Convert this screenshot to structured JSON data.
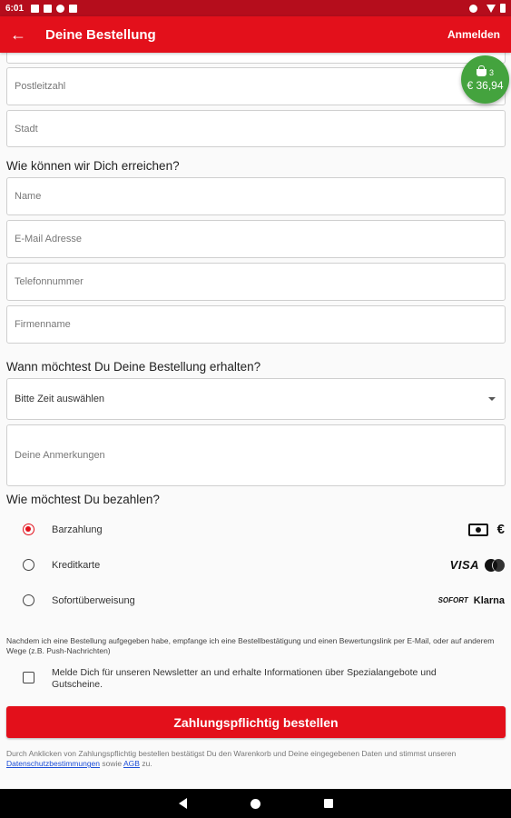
{
  "status_bar": {
    "time": "6:01"
  },
  "app_bar": {
    "back_icon": "arrow-left-icon",
    "title": "Deine Bestellung",
    "login_label": "Anmelden"
  },
  "basket": {
    "count": "3",
    "total": "€ 36,94",
    "color": "#44a33e"
  },
  "address": {
    "postal_placeholder": "Postleitzahl",
    "city_placeholder": "Stadt"
  },
  "contact": {
    "heading": "Wie können wir Dich erreichen?",
    "name_placeholder": "Name",
    "email_placeholder": "E-Mail Adresse",
    "phone_placeholder": "Telefonnummer",
    "company_placeholder": "Firmenname"
  },
  "delivery": {
    "heading": "Wann möchtest Du Deine Bestellung erhalten?",
    "time_select": "Bitte Zeit auswählen",
    "remarks_placeholder": "Deine Anmerkungen"
  },
  "payment": {
    "heading": "Wie möchtest Du bezahlen?",
    "selected": "Barzahlung",
    "options": [
      {
        "label": "Barzahlung",
        "icon_text": "€"
      },
      {
        "label": "Kreditkarte",
        "icon_text": "VISA"
      },
      {
        "label": "Sofortüberweisung",
        "icon_text": "SOFORT",
        "icon_text2": "Klarna"
      }
    ]
  },
  "info": {
    "confirmation_text": "Nachdem ich eine Bestellung aufgegeben habe, empfange ich eine Bestellbestätigung und einen Bewertungslink per E-Mail, oder auf anderem Wege (z.B. Push-Nachrichten)",
    "newsletter_text": "Melde Dich für unseren Newsletter an und erhalte Informationen über Spezialangebote und Gutscheine."
  },
  "order_button": "Zahlungspflichtig bestellen",
  "legal": {
    "text_before": "Durch Anklicken von Zahlungspflichtig bestellen bestätigst Du den Warenkorb und Deine eingegebenen Daten und stimmst unseren ",
    "privacy_link": "Datenschutzbestimmungen",
    "text_middle": " sowie ",
    "terms_link": "AGB",
    "text_after": " zu."
  },
  "colors": {
    "primary": "#e3101b",
    "status_bar": "#b50d1c"
  }
}
